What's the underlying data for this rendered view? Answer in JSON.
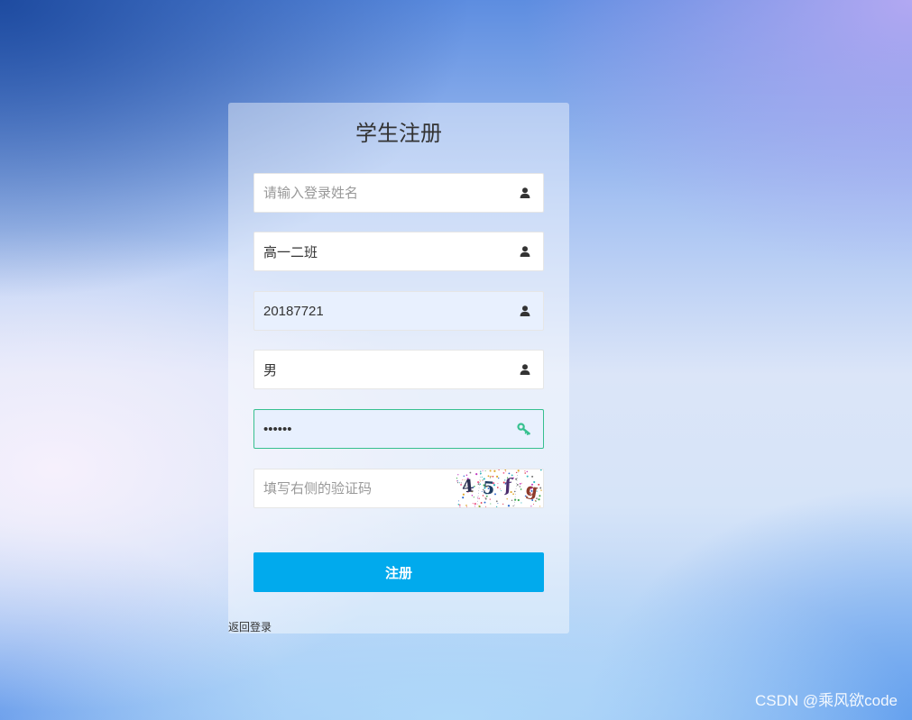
{
  "form": {
    "title": "学生注册",
    "fields": [
      {
        "placeholder": "请输入登录姓名",
        "icon": "user-icon"
      },
      {
        "value": "高一二班",
        "icon": "user-icon"
      },
      {
        "value": "20187721",
        "icon": "user-icon",
        "autofilled": true
      },
      {
        "value": "男",
        "icon": "user-icon"
      },
      {
        "value": "••••••",
        "icon": "key-icon",
        "focused": true,
        "autofilled": true
      }
    ],
    "captcha": {
      "placeholder": "填写右侧的验证码",
      "chars": [
        {
          "char": "4",
          "color": "#2a2d4f"
        },
        {
          "char": "5",
          "color": "#1f3d63"
        },
        {
          "char": "f",
          "color": "#4b2e6e"
        },
        {
          "char": "g",
          "color": "#8e3b2b"
        }
      ]
    },
    "submit_label": "注册",
    "back_link": "返回登录"
  },
  "watermark": "CSDN @乘风欲code",
  "colors": {
    "button": "#01aaed",
    "focus_border": "#36c08f",
    "key_icon": "#36c08f",
    "autofill_bg": "#e8f0fe",
    "text": "#333333",
    "placeholder": "#999999",
    "user_icon": "#333333"
  }
}
